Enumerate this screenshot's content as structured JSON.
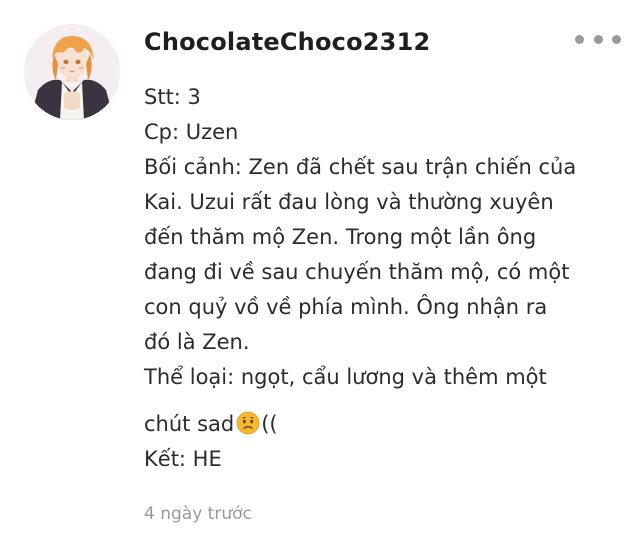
{
  "comment": {
    "username": "ChocolateChoco2312",
    "avatar_icon": "anime-character-avatar",
    "more_icon": "more-horizontal-icon",
    "lines": {
      "stt": "Stt: 3",
      "cp": "Cp: Uzen",
      "context_1": "Bối cảnh: Zen đã chết sau trận chiến của",
      "context_2": "Kai. Uzui rất đau lòng và thường xuyên",
      "context_3": "đến thăm mộ Zen. Trong một lần ông",
      "context_4": "đang đi về sau chuyến thăm mộ, có một",
      "context_5": "con quỷ vồ về phía mình. Ông nhận ra",
      "context_6": "đó là Zen.",
      "genre_1": "Thể loại: ngọt, cẩu lương và thêm một",
      "genre_2_before_emoji": "chút sad",
      "genre_2_after_emoji": "((",
      "ending": "Kết: HE"
    },
    "emoji_icon": "worried-face-emoji",
    "timestamp": "4 ngày trước"
  },
  "colors": {
    "text": "#2c2c2c",
    "muted": "#9a9a9a",
    "emoji": "#f5b82e"
  }
}
